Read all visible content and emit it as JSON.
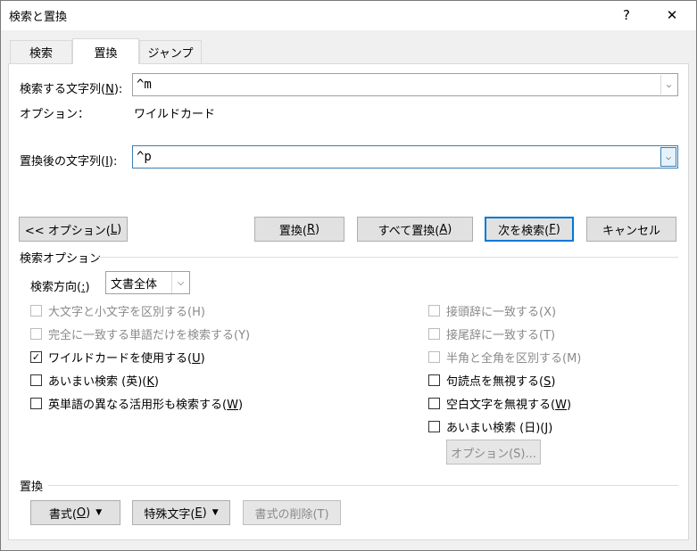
{
  "window": {
    "title": "検索と置換",
    "help_glyph": "?",
    "close_glyph": "✕"
  },
  "tabs": [
    {
      "label": "検索",
      "active": false
    },
    {
      "label": "置換",
      "active": true
    },
    {
      "label": "ジャンプ",
      "active": false
    }
  ],
  "find": {
    "label_prefix": "検索する文字列(",
    "label_key": "N",
    "label_suffix": "):",
    "value": "^m"
  },
  "options_line": {
    "label": "オプション：",
    "value": "ワイルドカード"
  },
  "replace": {
    "label_prefix": "置換後の文字列(",
    "label_key": "I",
    "label_suffix": "):",
    "value": "^p"
  },
  "buttons": {
    "less_options": {
      "prefix": "<< オプション(",
      "key": "L",
      "suffix": ")"
    },
    "replace": {
      "prefix": "置換(",
      "key": "R",
      "suffix": ")"
    },
    "replace_all": {
      "prefix": "すべて置換(",
      "key": "A",
      "suffix": ")"
    },
    "find_next": {
      "prefix": "次を検索(",
      "key": "F",
      "suffix": ")"
    },
    "cancel": "キャンセル"
  },
  "search_options": {
    "heading": "検索オプション",
    "direction_label_prefix": "検索方向(",
    "direction_label_key": ":",
    "direction_label_suffix": ")",
    "direction_value": "文書全体",
    "left": [
      {
        "label": "大文字と小文字を区別する(H)",
        "checked": false,
        "enabled": false
      },
      {
        "label": "完全に一致する単語だけを検索する(Y)",
        "checked": false,
        "enabled": false
      },
      {
        "label_prefix": "ワイルドカードを使用する(",
        "key": "U",
        "suffix": ")",
        "checked": true,
        "enabled": true
      },
      {
        "label_prefix": "あいまい検索 (英)(",
        "key": "K",
        "suffix": ")",
        "checked": false,
        "enabled": true
      },
      {
        "label_prefix": "英単語の異なる活用形も検索する(",
        "key": "W",
        "suffix": ")",
        "checked": false,
        "enabled": true
      }
    ],
    "right": [
      {
        "label": "接頭辞に一致する(X)",
        "checked": false,
        "enabled": false
      },
      {
        "label": "接尾辞に一致する(T)",
        "checked": false,
        "enabled": false
      },
      {
        "label": "半角と全角を区別する(M)",
        "checked": false,
        "enabled": false
      },
      {
        "label_prefix": "句読点を無視する(",
        "key": "S",
        "suffix": ")",
        "checked": false,
        "enabled": true
      },
      {
        "label_prefix": "空白文字を無視する(",
        "key": "W",
        "suffix": ")",
        "checked": false,
        "enabled": true
      },
      {
        "label_prefix": "あいまい検索 (日)(",
        "key": "J",
        "suffix": ")",
        "checked": false,
        "enabled": true
      }
    ],
    "options_button": "オプション(S)..."
  },
  "replace_section": {
    "heading": "置換",
    "format": {
      "prefix": "書式(",
      "key": "O",
      "suffix": ")"
    },
    "special": {
      "prefix": "特殊文字(",
      "key": "E",
      "suffix": ")"
    },
    "no_format": "書式の削除(T)",
    "dropdown_glyph": "▼"
  },
  "checkmark_glyph": "✓",
  "combo_arrow_glyph": "⌵"
}
